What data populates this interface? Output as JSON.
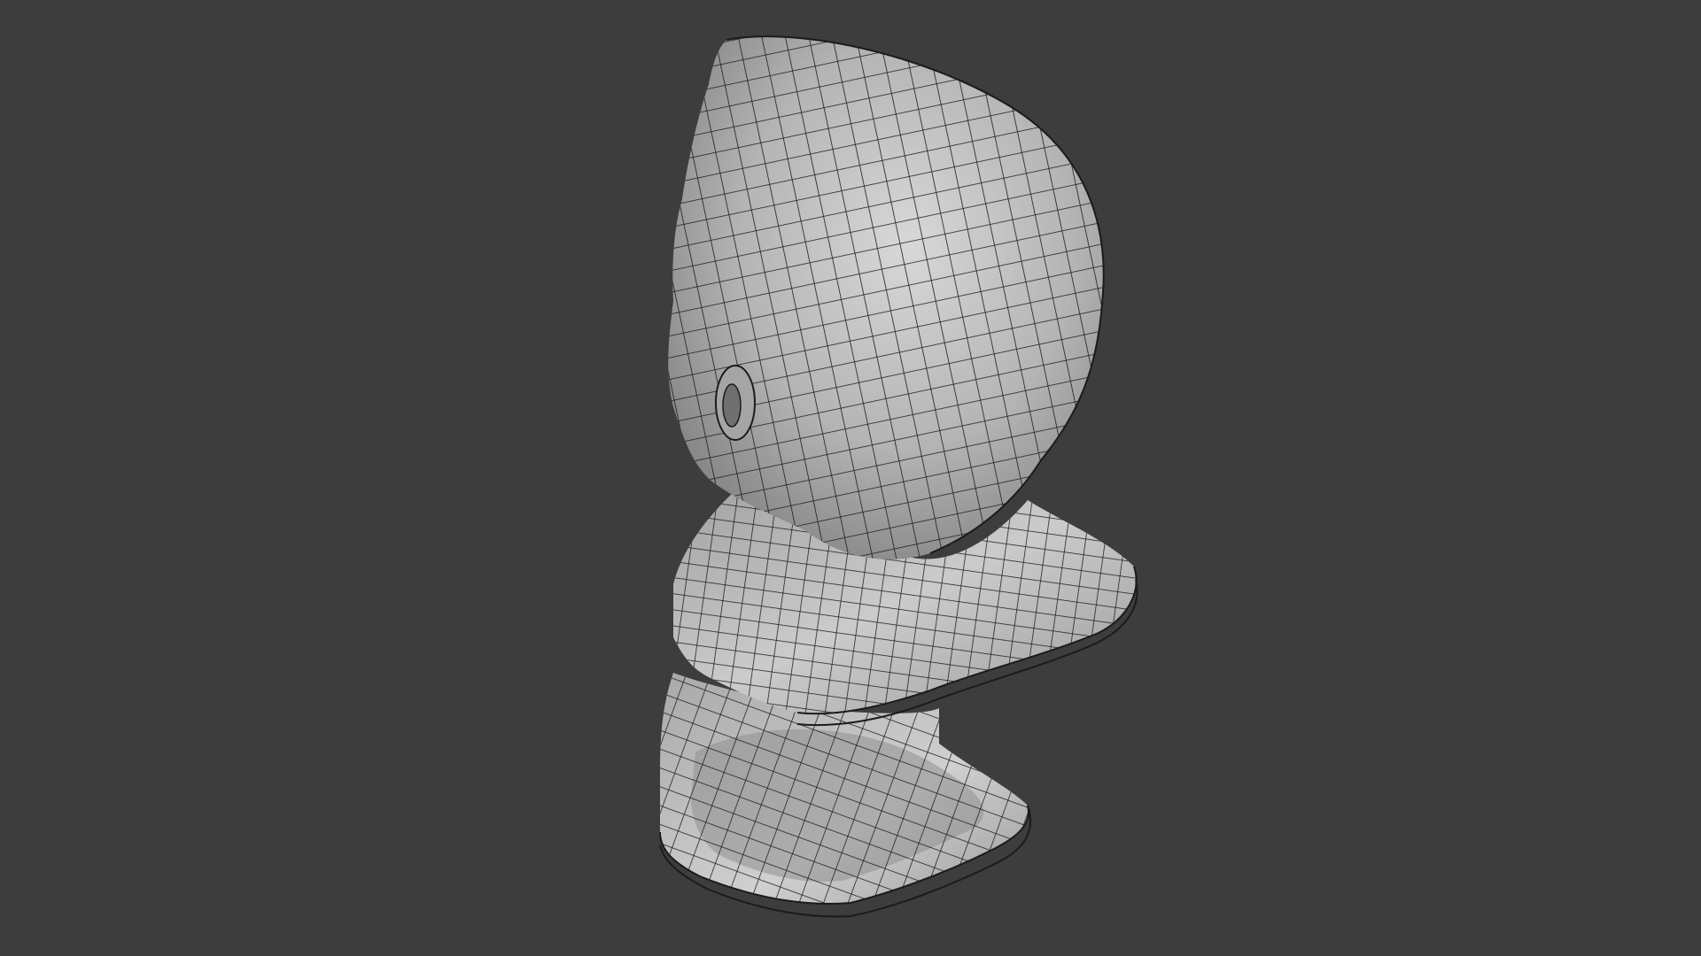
{
  "viewport": {
    "background_color": "#3d3d3d",
    "mesh_fill_color": "#bdbdbd",
    "mesh_shadow_color": "#8a8a8a",
    "wire_color": "#1b1b1b",
    "shading_mode": "solid",
    "overlay": "wireframe",
    "object": "bust-head-mesh"
  }
}
